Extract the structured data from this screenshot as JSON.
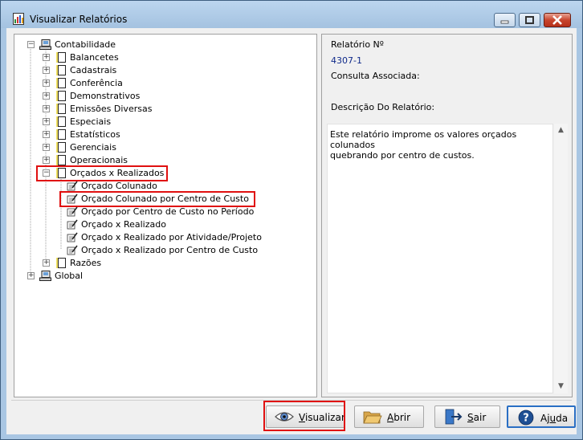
{
  "window": {
    "title": "Visualizar Relatórios"
  },
  "tree": {
    "root": {
      "label": "Contabilidade",
      "expanded": true
    },
    "groups": [
      {
        "label": "Balancetes"
      },
      {
        "label": "Cadastrais"
      },
      {
        "label": "Conferência"
      },
      {
        "label": "Demonstrativos"
      },
      {
        "label": "Emissões Diversas"
      },
      {
        "label": "Especiais"
      },
      {
        "label": "Estatísticos"
      },
      {
        "label": "Gerenciais"
      },
      {
        "label": "Operacionais"
      },
      {
        "label": "Orçados x Realizados",
        "expanded": true
      }
    ],
    "reports": [
      {
        "label": "Orçado Colunado"
      },
      {
        "label": "Orçado Colunado por Centro de Custo",
        "selected": true
      },
      {
        "label": "Orçado por Centro de Custo no Período"
      },
      {
        "label": "Orçado x Realizado"
      },
      {
        "label": "Orçado x Realizado por Atividade/Projeto"
      },
      {
        "label": "Orçado x Realizado por Centro de Custo"
      }
    ],
    "after_group": {
      "label": "Razões"
    },
    "root2": {
      "label": "Global"
    }
  },
  "details": {
    "report_number_label": "Relatório Nº",
    "report_number": "4307-1",
    "associated_query_label": "Consulta Associada:",
    "description_label": "Descrição Do Relatório:",
    "description": "Este relatório improme os valores orçados colunados\nquebrando por centro de custos."
  },
  "buttons": {
    "visualizar": {
      "first": "V",
      "rest": "isualizar"
    },
    "abrir": {
      "first": "A",
      "rest": "brir"
    },
    "sair": {
      "first": "S",
      "rest": "air"
    },
    "ajuda": {
      "pre": "Aj",
      "under": "u",
      "post": "da"
    }
  },
  "colors": {
    "highlight": "#e01010",
    "title_bar": "#a9c6e3",
    "value_text": "#102a8a"
  }
}
